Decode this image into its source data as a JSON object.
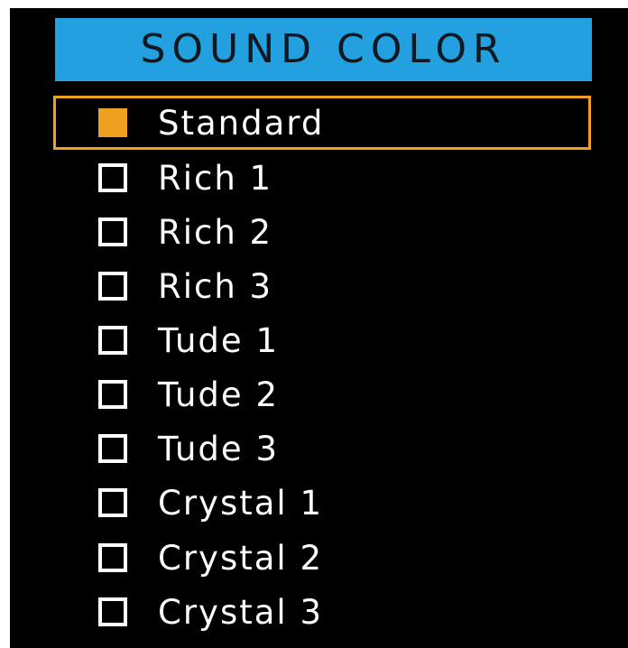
{
  "header": {
    "title": "SOUND COLOR"
  },
  "colors": {
    "panel_background": "#000000",
    "header_background": "#22a0e0",
    "header_text": "#111820",
    "item_text": "#ffffff",
    "selection_accent": "#f0a020"
  },
  "menu": {
    "selected_index": 0,
    "items": [
      {
        "label": "Standard",
        "checked": true
      },
      {
        "label": "Rich 1",
        "checked": false
      },
      {
        "label": "Rich 2",
        "checked": false
      },
      {
        "label": "Rich 3",
        "checked": false
      },
      {
        "label": "Tude 1",
        "checked": false
      },
      {
        "label": "Tude 2",
        "checked": false
      },
      {
        "label": "Tude 3",
        "checked": false
      },
      {
        "label": "Crystal 1",
        "checked": false
      },
      {
        "label": "Crystal 2",
        "checked": false
      },
      {
        "label": "Crystal 3",
        "checked": false
      }
    ]
  }
}
